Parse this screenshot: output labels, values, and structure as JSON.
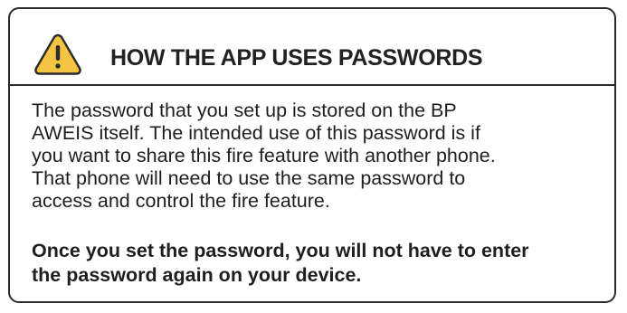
{
  "notice": {
    "icon": "warning-triangle-icon",
    "title": "HOW THE APP USES PASSWORDS",
    "body_lines": [
      "The password that you set up is stored on the BP",
      "AWEIS itself. The intended use of this password is if",
      "you want to share this fire feature with another phone.",
      "That phone will need to use the same password to",
      "access and control the fire feature."
    ],
    "note_lines": [
      "Once you set the password, you will not have to enter",
      "the password again on your device."
    ]
  },
  "colors": {
    "warning_fill": "#f4c542",
    "warning_stroke": "#2a2a2a",
    "border": "#2a2a2a",
    "text": "#1e1e1e"
  }
}
